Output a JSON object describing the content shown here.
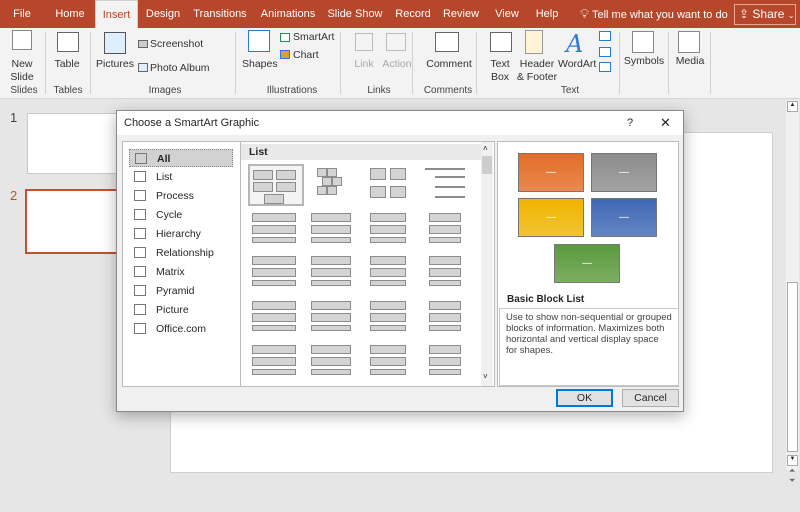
{
  "tabs": [
    "File",
    "Home",
    "Insert",
    "Design",
    "Transitions",
    "Animations",
    "Slide Show",
    "Record",
    "Review",
    "View",
    "Help"
  ],
  "active_tab": "Insert",
  "tell_me": "Tell me what you want to do",
  "share": "Share",
  "ribbon": {
    "new_slide": "New Slide",
    "table": "Table",
    "pictures": "Pictures",
    "screenshot": "Screenshot",
    "photo_album": "Photo Album",
    "shapes": "Shapes",
    "smartart": "SmartArt",
    "chart": "Chart",
    "link": "Link",
    "action": "Action",
    "comment": "Comment",
    "text_box": "Text Box",
    "header_footer": "Header & Footer",
    "wordart": "WordArt",
    "symbols": "Symbols",
    "media": "Media",
    "groups": {
      "slides": "Slides",
      "tables": "Tables",
      "images": "Images",
      "illustrations": "Illustrations",
      "links": "Links",
      "comments": "Comments",
      "text": "Text"
    }
  },
  "slides": [
    {
      "number": "1"
    },
    {
      "number": "2",
      "selected": true
    }
  ],
  "dialog": {
    "title": "Choose a SmartArt Graphic",
    "help": "?",
    "close": "✕",
    "categories": [
      "All",
      "List",
      "Process",
      "Cycle",
      "Hierarchy",
      "Relationship",
      "Matrix",
      "Pyramid",
      "Picture",
      "Office.com"
    ],
    "selected_category": "All",
    "gallery_header": "List",
    "preview": {
      "name": "Basic Block List",
      "description": "Use to show non-sequential or grouped blocks of information. Maximizes both horizontal and vertical display space for shapes.",
      "block_text": "—",
      "colors": [
        "#e46c25",
        "#8c8c8c",
        "#f0b400",
        "#3f67b5",
        "#5a9a3c"
      ]
    },
    "ok": "OK",
    "cancel": "Cancel"
  },
  "colors": {
    "accent": "#b7472a"
  }
}
